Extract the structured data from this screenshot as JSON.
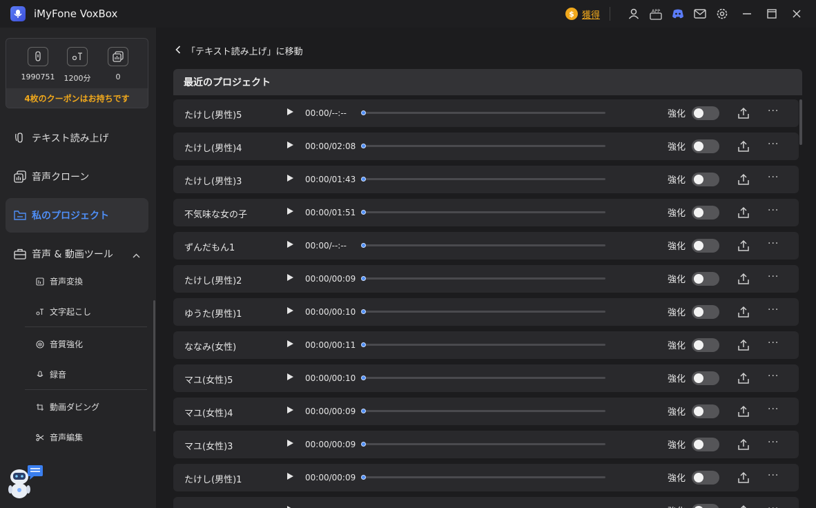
{
  "app": {
    "title": "iMyFone VoxBox"
  },
  "titlebar": {
    "acquire_label": "獲得",
    "coin_symbol": "$",
    "app_badge": "APP",
    "icons": [
      "coin-icon",
      "user-icon",
      "app-icon",
      "discord-icon",
      "mail-icon",
      "settings-icon",
      "minimize-icon",
      "maximize-icon",
      "close-icon"
    ]
  },
  "stats": {
    "chars": "1990751",
    "minutes": "1200分",
    "clones": "0",
    "coupon": "4枚のクーポンはお持ちです"
  },
  "nav": {
    "tts": "テキスト読み上げ",
    "clone": "音声クローン",
    "projects": "私のプロジェクト",
    "tools": "音声 & 動画ツール"
  },
  "subnav": {
    "voice_change": "音声変換",
    "transcribe": "文字起こし",
    "enhance": "音質強化",
    "record": "録音",
    "dubbing": "動画ダビング",
    "edit": "音声編集"
  },
  "main": {
    "back_label": "「テキスト読み上げ」に移動",
    "section_title": "最近のプロジェクト",
    "enhance_label": "強化",
    "more_label": "···",
    "projects": [
      {
        "name": "たけし(男性)5",
        "time": "00:00/--:--"
      },
      {
        "name": "たけし(男性)4",
        "time": "00:00/02:08"
      },
      {
        "name": "たけし(男性)3",
        "time": "00:00/01:43"
      },
      {
        "name": "不気味な女の子",
        "time": "00:00/01:51"
      },
      {
        "name": "ずんだもん1",
        "time": "00:00/--:--"
      },
      {
        "name": "たけし(男性)2",
        "time": "00:00/00:09"
      },
      {
        "name": "ゆうた(男性)1",
        "time": "00:00/00:10"
      },
      {
        "name": "ななみ(女性)",
        "time": "00:00/00:11"
      },
      {
        "name": "マユ(女性)5",
        "time": "00:00/00:10"
      },
      {
        "name": "マユ(女性)4",
        "time": "00:00/00:09"
      },
      {
        "name": "マユ(女性)3",
        "time": "00:00/00:09"
      },
      {
        "name": "たけし(男性)1",
        "time": "00:00/00:09"
      },
      {
        "name": "",
        "time": ""
      }
    ]
  },
  "colors": {
    "accent": "#4f8ff7",
    "gold": "#f0a81c",
    "bg": "#1c1c1e",
    "sidebar": "#252527",
    "row": "#29292c"
  }
}
